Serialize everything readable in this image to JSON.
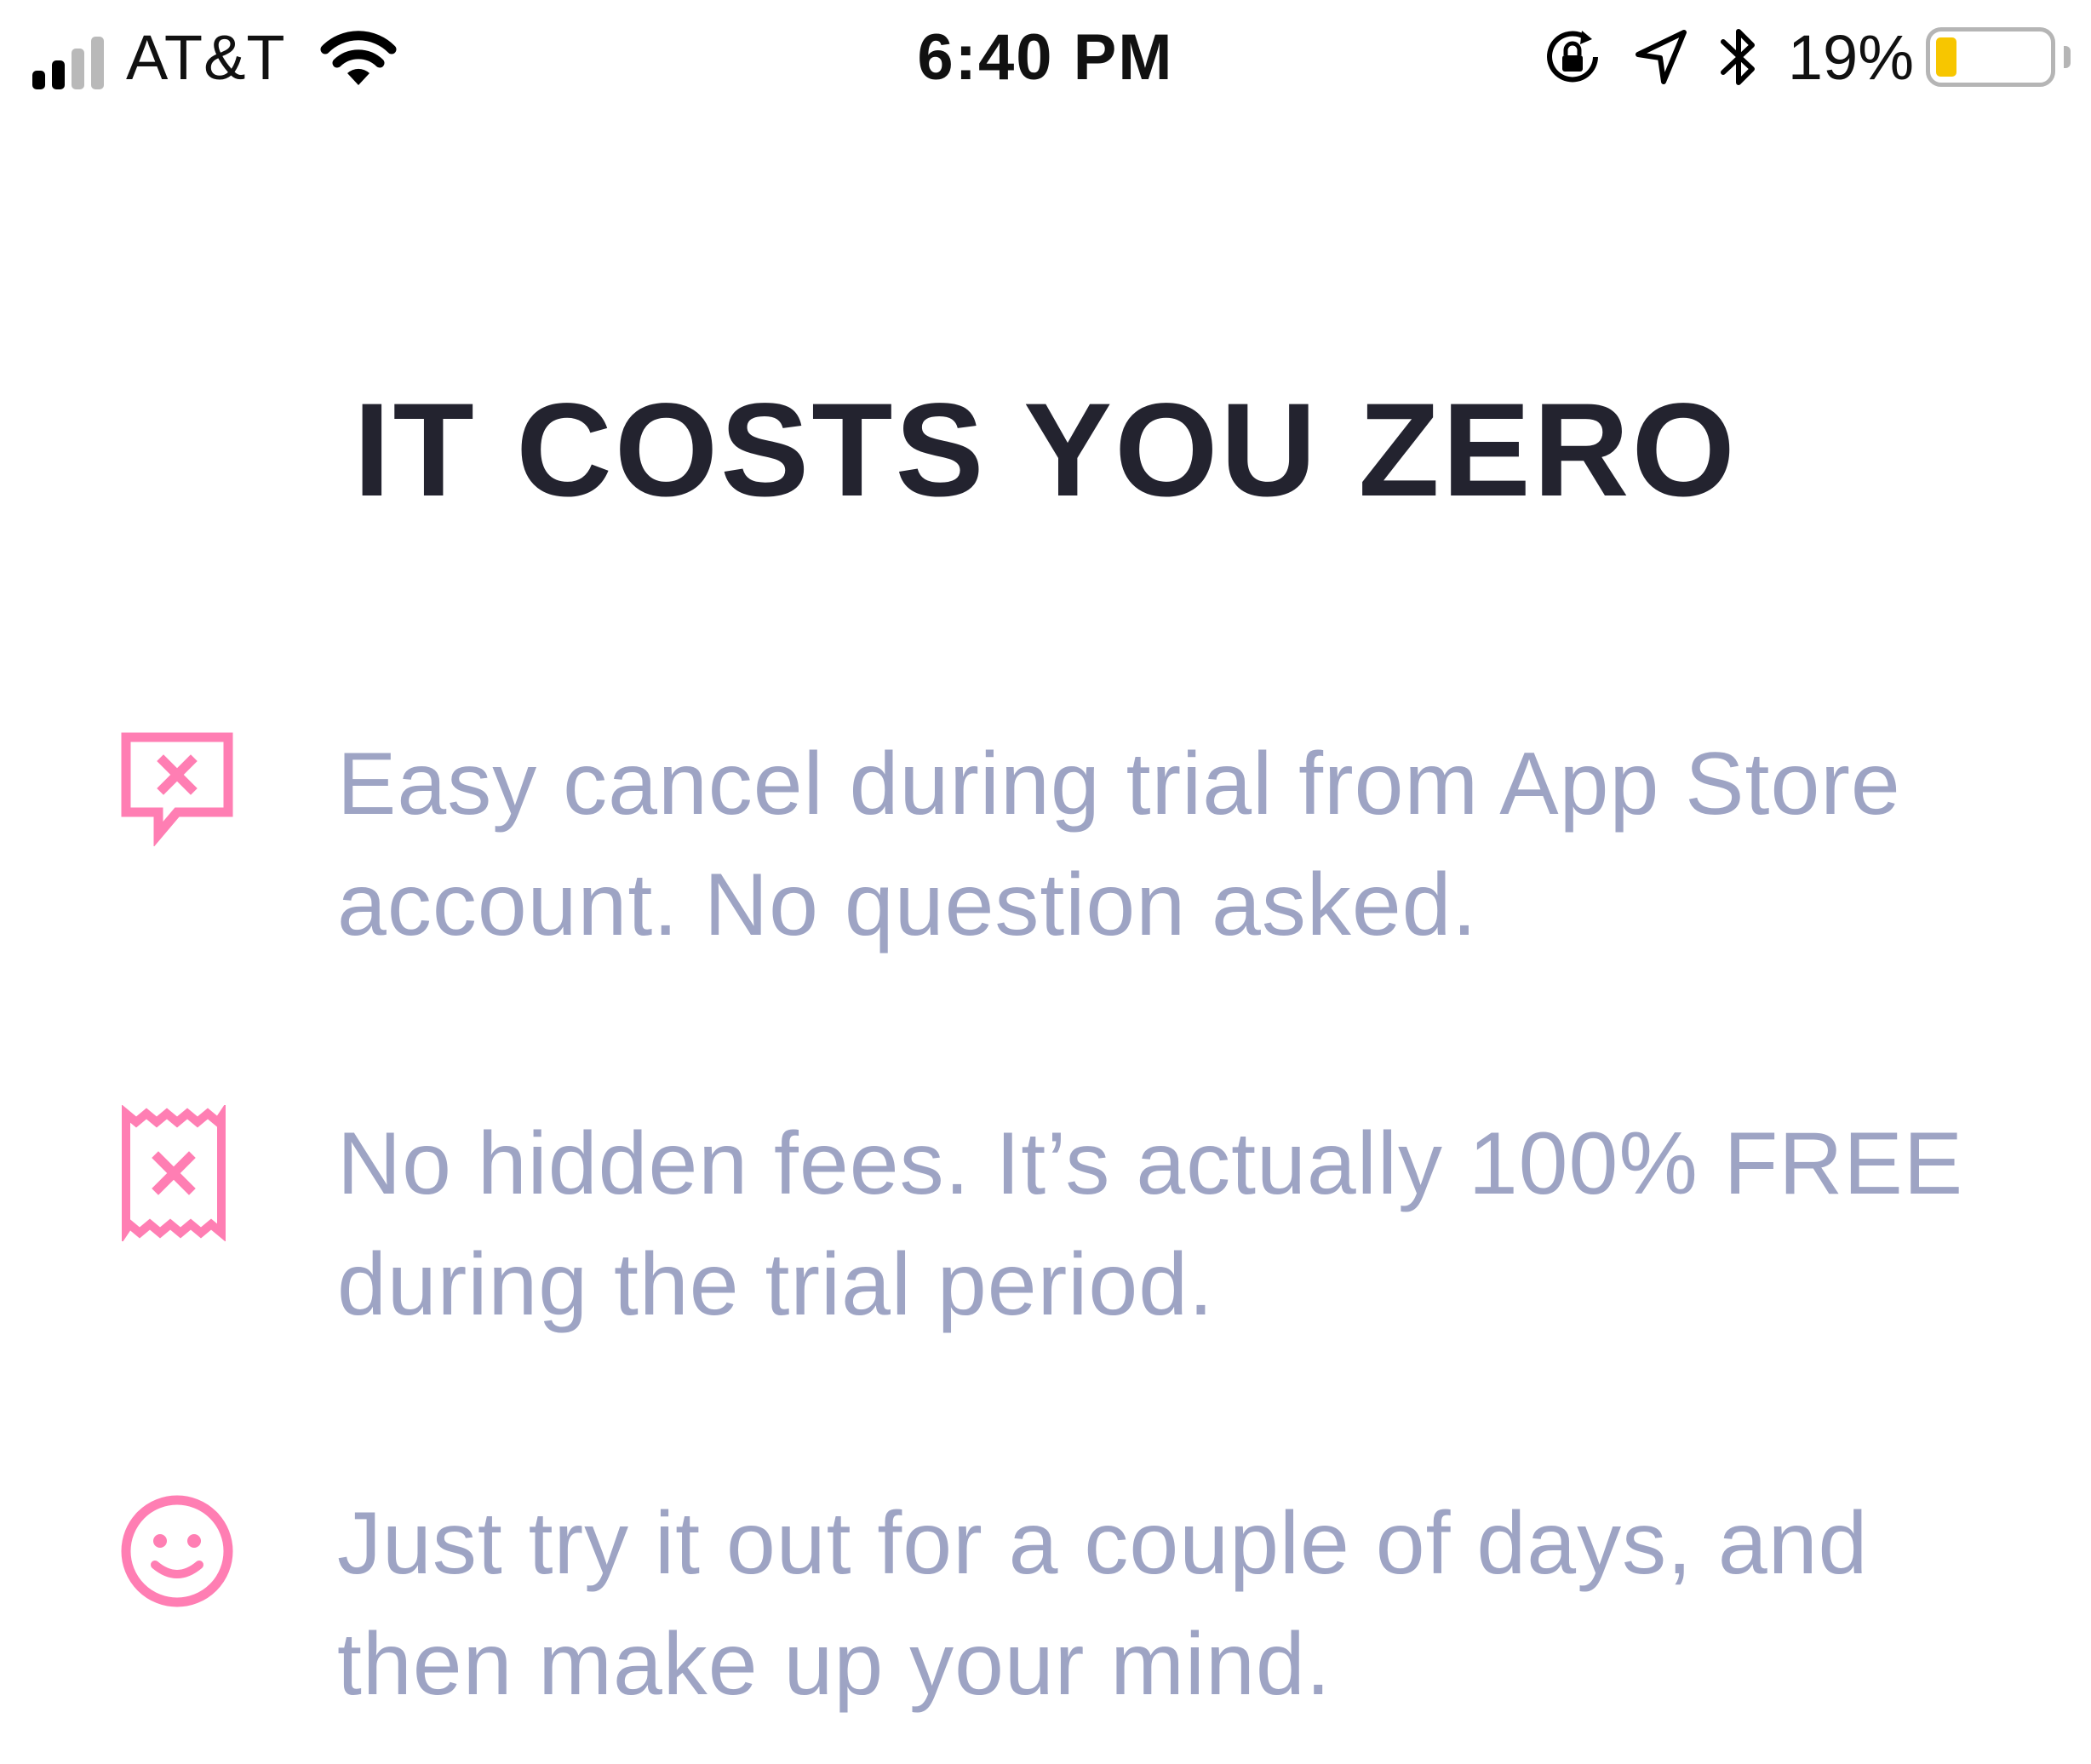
{
  "status_bar": {
    "carrier": "AT&T",
    "time": "6:40 PM",
    "battery_percent": "19%",
    "battery_level": 0.19,
    "battery_color": "#f7c600",
    "icons": [
      "signal-icon",
      "wifi-icon",
      "rotation-lock-icon",
      "location-arrow-icon",
      "bluetooth-icon",
      "battery-icon"
    ]
  },
  "page": {
    "title": "IT COSTS YOU ZERO"
  },
  "features": [
    {
      "icon": "cancel-speech-bubble-icon",
      "line1": "Easy cancel during trial from App Store",
      "line2": "account. No question asked."
    },
    {
      "icon": "cancelled-receipt-icon",
      "line1": "No hidden fees. It’s actually 100% FREE",
      "line2": "during the trial period."
    },
    {
      "icon": "smiley-face-icon",
      "line1": "Just try it out for a couple of days, and",
      "line2": "then make up your mind."
    }
  ],
  "colors": {
    "accent": "#ff7eb3",
    "title": "#23232f",
    "body_text": "#9ea4c4"
  }
}
